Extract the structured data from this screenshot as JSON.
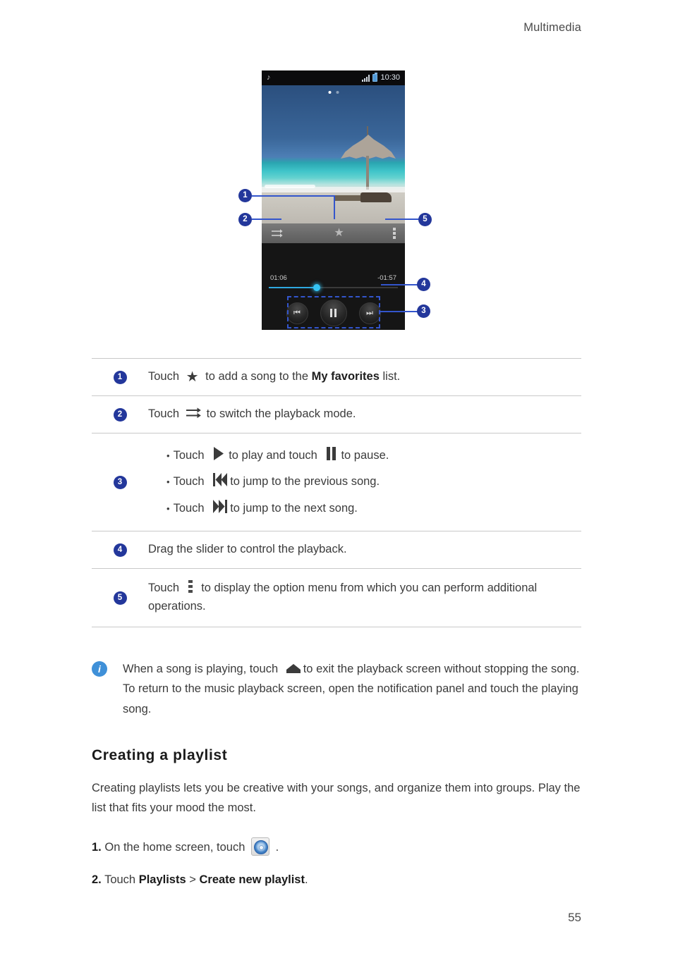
{
  "header": {
    "chapter": "Multimedia"
  },
  "page_number": "55",
  "phone": {
    "status_bar": {
      "music_note_icon": "music-note-icon",
      "signal_icon": "signal-bars-icon",
      "battery_icon": "battery-icon",
      "time": "10:30"
    },
    "toolbar": {
      "playback_mode_icon": "shuffle-arrows-icon",
      "favorite_icon": "star-icon",
      "overflow_menu_icon": "vertical-dots-icon"
    },
    "playback": {
      "elapsed_time": "01:06",
      "remaining_time": "-01:57",
      "progress_percent": 37,
      "previous_icon": "previous-track-icon",
      "pause_icon": "pause-icon",
      "next_icon": "next-track-icon"
    }
  },
  "callouts": [
    {
      "number": "1",
      "target": "star-icon"
    },
    {
      "number": "2",
      "target": "playback-mode-icon"
    },
    {
      "number": "3",
      "target": "transport-controls"
    },
    {
      "number": "4",
      "target": "progress-slider"
    },
    {
      "number": "5",
      "target": "overflow-menu-icon"
    }
  ],
  "legend": {
    "rows": [
      {
        "number": "1",
        "parts": [
          {
            "type": "text",
            "value": "Touch "
          },
          {
            "type": "icon",
            "value": "star-icon"
          },
          {
            "type": "text",
            "value": " to add a song to the "
          },
          {
            "type": "bold",
            "value": "My favorites"
          },
          {
            "type": "text",
            "value": " list."
          }
        ],
        "plain": "Touch ★ to add a song to the My favorites list."
      },
      {
        "number": "2",
        "plain": "Touch ⇉ to switch the playback mode.",
        "before": "Touch ",
        "after": "to switch the playback mode."
      },
      {
        "number": "3",
        "bullets": [
          {
            "before": "Touch ",
            "middle": "to play and touch ",
            "after": "to pause.",
            "icon1": "play-icon",
            "icon2": "pause-icon",
            "plain": "Touch ▶ to play and touch ❙❙ to pause."
          },
          {
            "before": "Touch ",
            "after": "to jump to the previous song.",
            "icon1": "previous-track-icon",
            "plain": "Touch ⏮ to jump to the previous song."
          },
          {
            "before": "Touch ",
            "after": "to jump to the next song.",
            "icon1": "next-track-icon",
            "plain": "Touch ⏭ to jump to the next song."
          }
        ]
      },
      {
        "number": "4",
        "plain": "Drag the slider to control the playback."
      },
      {
        "number": "5",
        "before": "Touch ",
        "after": " to display the option menu from which you can perform additional operations.",
        "icon": "vertical-dots-icon",
        "plain": "Touch ⋮ to display the option menu from which you can perform additional operations."
      }
    ]
  },
  "note": {
    "icon": "info-icon",
    "before": "When a song is playing, touch ",
    "icon_inline": "home-icon",
    "after": "to exit the playback screen without stopping the song. To return to the music playback screen, open the notification panel and touch the playing song."
  },
  "section": {
    "title": "Creating a playlist",
    "intro": "Creating playlists lets you be creative with your songs, and organize them into groups. Play the list that fits your mood the most.",
    "steps": [
      {
        "number": "1.",
        "before": "On the home screen, touch ",
        "icon": "music-disc-icon",
        "after": " ."
      },
      {
        "number": "2.",
        "before": "Touch ",
        "bold1": "Playlists",
        "separator": ">",
        "bold2": "Create new playlist",
        "after": "."
      }
    ]
  },
  "colors": {
    "marker_blue": "#23379b",
    "leader_blue": "#3355cc",
    "info_blue": "#3f90d8",
    "slider_blue": "#2fa8e0"
  }
}
